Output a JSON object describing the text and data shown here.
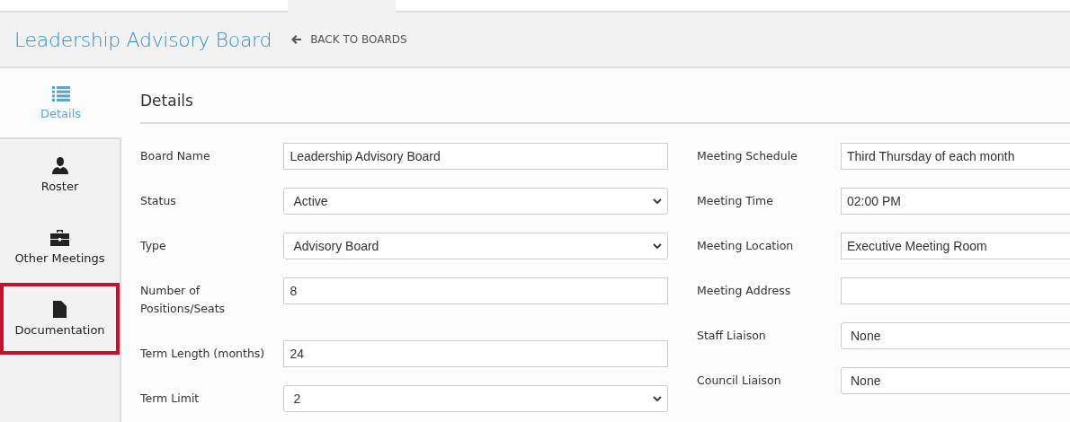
{
  "header": {
    "title": "Leadership Advisory Board",
    "back_link": "BACK TO BOARDS"
  },
  "sidebar": {
    "items": [
      {
        "label": "Details",
        "selected": true,
        "highlighted": false
      },
      {
        "label": "Roster",
        "selected": false,
        "highlighted": false
      },
      {
        "label": "Other Meetings",
        "selected": false,
        "highlighted": false
      },
      {
        "label": "Documentation",
        "selected": false,
        "highlighted": true
      }
    ]
  },
  "section_title": "Details",
  "form": {
    "left": [
      {
        "label": "Board Name",
        "kind": "text",
        "value": "Leadership Advisory Board"
      },
      {
        "label": "Status",
        "kind": "select",
        "value": "Active"
      },
      {
        "label": "Type",
        "kind": "select",
        "value": "Advisory Board"
      },
      {
        "label": "Number of Positions/Seats",
        "kind": "text",
        "value": "8"
      },
      {
        "label": "Term Length (months)",
        "kind": "text",
        "value": "24"
      },
      {
        "label": "Term Limit",
        "kind": "select",
        "value": "2"
      }
    ],
    "right": [
      {
        "label": "Meeting Schedule",
        "kind": "text",
        "value": "Third Thursday of each month"
      },
      {
        "label": "Meeting Time",
        "kind": "text",
        "value": "02:00 PM"
      },
      {
        "label": "Meeting Location",
        "kind": "text",
        "value": "Executive Meeting Room"
      },
      {
        "label": "Meeting Address",
        "kind": "text"
      },
      {
        "label": "Staff Liaison",
        "kind": "select",
        "value": "None"
      },
      {
        "label": "Council Liaison",
        "kind": "select",
        "value": "None"
      }
    ]
  }
}
